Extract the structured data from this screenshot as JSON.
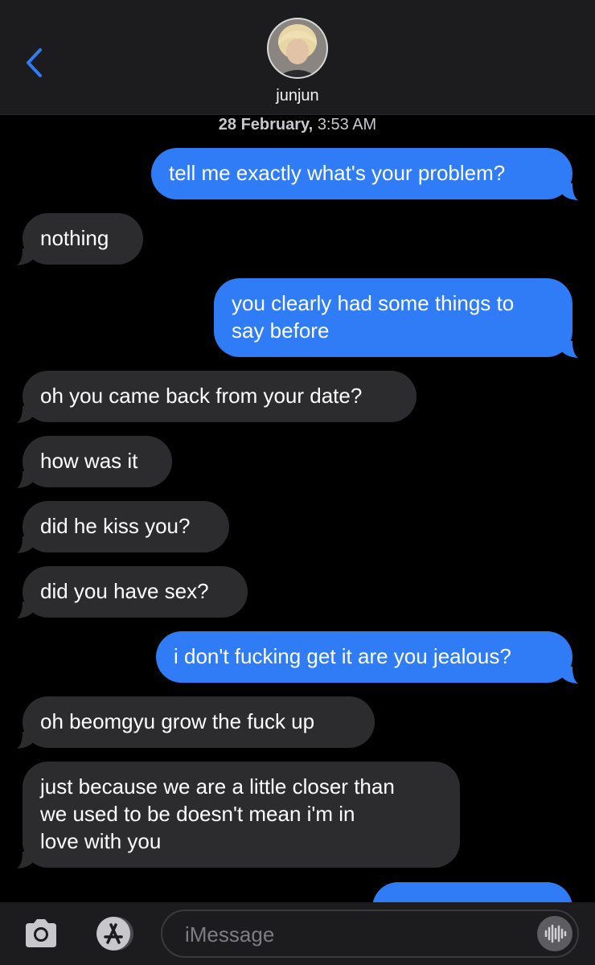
{
  "header": {
    "contact_name": "junjun",
    "back_icon": "chevron-left-icon"
  },
  "thread": {
    "timestamp_date": "28 February,",
    "timestamp_time": "3:53 AM",
    "messages": [
      {
        "from": "me",
        "lines": [
          "tell me exactly what's your problem?"
        ]
      },
      {
        "from": "them",
        "lines": [
          "nothing"
        ]
      },
      {
        "from": "me",
        "lines": [
          "you clearly had some things to",
          "say before"
        ]
      },
      {
        "from": "them",
        "lines": [
          "oh you came back from your date?"
        ]
      },
      {
        "from": "them",
        "lines": [
          "how was it"
        ]
      },
      {
        "from": "them",
        "lines": [
          "did he kiss you?"
        ]
      },
      {
        "from": "them",
        "lines": [
          "did you have sex?"
        ]
      },
      {
        "from": "me",
        "lines": [
          "i don't fucking get it are you jealous?"
        ]
      },
      {
        "from": "them",
        "lines": [
          "oh beomgyu grow the fuck up"
        ]
      },
      {
        "from": "them",
        "lines": [
          "just because we are a little closer than",
          "we used to be doesn't mean i'm in",
          "love with you"
        ]
      }
    ]
  },
  "composer": {
    "placeholder": "iMessage",
    "camera_icon": "camera-icon",
    "appstore_icon": "app-store-icon",
    "voice_icon": "voice-waveform-icon"
  },
  "colors": {
    "outgoing_bubble": "#2f7cf6",
    "incoming_bubble": "#2c2c2e",
    "background": "#000000",
    "header": "#1c1c1e"
  }
}
